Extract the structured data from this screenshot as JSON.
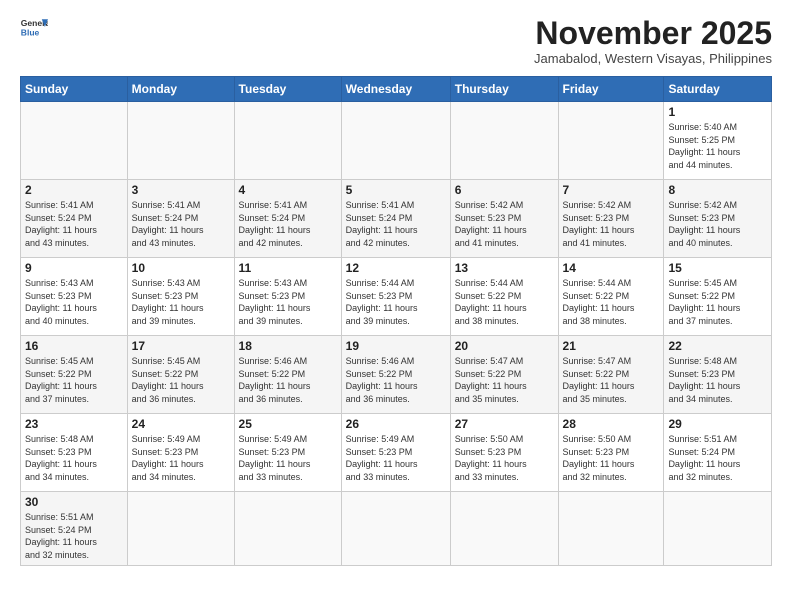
{
  "header": {
    "logo_general": "General",
    "logo_blue": "Blue",
    "month_title": "November 2025",
    "subtitle": "Jamabalod, Western Visayas, Philippines"
  },
  "weekdays": [
    "Sunday",
    "Monday",
    "Tuesday",
    "Wednesday",
    "Thursday",
    "Friday",
    "Saturday"
  ],
  "weeks": [
    [
      {
        "day": "",
        "info": ""
      },
      {
        "day": "",
        "info": ""
      },
      {
        "day": "",
        "info": ""
      },
      {
        "day": "",
        "info": ""
      },
      {
        "day": "",
        "info": ""
      },
      {
        "day": "",
        "info": ""
      },
      {
        "day": "1",
        "info": "Sunrise: 5:40 AM\nSunset: 5:25 PM\nDaylight: 11 hours\nand 44 minutes."
      }
    ],
    [
      {
        "day": "2",
        "info": "Sunrise: 5:41 AM\nSunset: 5:24 PM\nDaylight: 11 hours\nand 43 minutes."
      },
      {
        "day": "3",
        "info": "Sunrise: 5:41 AM\nSunset: 5:24 PM\nDaylight: 11 hours\nand 43 minutes."
      },
      {
        "day": "4",
        "info": "Sunrise: 5:41 AM\nSunset: 5:24 PM\nDaylight: 11 hours\nand 42 minutes."
      },
      {
        "day": "5",
        "info": "Sunrise: 5:41 AM\nSunset: 5:24 PM\nDaylight: 11 hours\nand 42 minutes."
      },
      {
        "day": "6",
        "info": "Sunrise: 5:42 AM\nSunset: 5:23 PM\nDaylight: 11 hours\nand 41 minutes."
      },
      {
        "day": "7",
        "info": "Sunrise: 5:42 AM\nSunset: 5:23 PM\nDaylight: 11 hours\nand 41 minutes."
      },
      {
        "day": "8",
        "info": "Sunrise: 5:42 AM\nSunset: 5:23 PM\nDaylight: 11 hours\nand 40 minutes."
      }
    ],
    [
      {
        "day": "9",
        "info": "Sunrise: 5:43 AM\nSunset: 5:23 PM\nDaylight: 11 hours\nand 40 minutes."
      },
      {
        "day": "10",
        "info": "Sunrise: 5:43 AM\nSunset: 5:23 PM\nDaylight: 11 hours\nand 39 minutes."
      },
      {
        "day": "11",
        "info": "Sunrise: 5:43 AM\nSunset: 5:23 PM\nDaylight: 11 hours\nand 39 minutes."
      },
      {
        "day": "12",
        "info": "Sunrise: 5:44 AM\nSunset: 5:23 PM\nDaylight: 11 hours\nand 39 minutes."
      },
      {
        "day": "13",
        "info": "Sunrise: 5:44 AM\nSunset: 5:22 PM\nDaylight: 11 hours\nand 38 minutes."
      },
      {
        "day": "14",
        "info": "Sunrise: 5:44 AM\nSunset: 5:22 PM\nDaylight: 11 hours\nand 38 minutes."
      },
      {
        "day": "15",
        "info": "Sunrise: 5:45 AM\nSunset: 5:22 PM\nDaylight: 11 hours\nand 37 minutes."
      }
    ],
    [
      {
        "day": "16",
        "info": "Sunrise: 5:45 AM\nSunset: 5:22 PM\nDaylight: 11 hours\nand 37 minutes."
      },
      {
        "day": "17",
        "info": "Sunrise: 5:45 AM\nSunset: 5:22 PM\nDaylight: 11 hours\nand 36 minutes."
      },
      {
        "day": "18",
        "info": "Sunrise: 5:46 AM\nSunset: 5:22 PM\nDaylight: 11 hours\nand 36 minutes."
      },
      {
        "day": "19",
        "info": "Sunrise: 5:46 AM\nSunset: 5:22 PM\nDaylight: 11 hours\nand 36 minutes."
      },
      {
        "day": "20",
        "info": "Sunrise: 5:47 AM\nSunset: 5:22 PM\nDaylight: 11 hours\nand 35 minutes."
      },
      {
        "day": "21",
        "info": "Sunrise: 5:47 AM\nSunset: 5:22 PM\nDaylight: 11 hours\nand 35 minutes."
      },
      {
        "day": "22",
        "info": "Sunrise: 5:48 AM\nSunset: 5:23 PM\nDaylight: 11 hours\nand 34 minutes."
      }
    ],
    [
      {
        "day": "23",
        "info": "Sunrise: 5:48 AM\nSunset: 5:23 PM\nDaylight: 11 hours\nand 34 minutes."
      },
      {
        "day": "24",
        "info": "Sunrise: 5:49 AM\nSunset: 5:23 PM\nDaylight: 11 hours\nand 34 minutes."
      },
      {
        "day": "25",
        "info": "Sunrise: 5:49 AM\nSunset: 5:23 PM\nDaylight: 11 hours\nand 33 minutes."
      },
      {
        "day": "26",
        "info": "Sunrise: 5:49 AM\nSunset: 5:23 PM\nDaylight: 11 hours\nand 33 minutes."
      },
      {
        "day": "27",
        "info": "Sunrise: 5:50 AM\nSunset: 5:23 PM\nDaylight: 11 hours\nand 33 minutes."
      },
      {
        "day": "28",
        "info": "Sunrise: 5:50 AM\nSunset: 5:23 PM\nDaylight: 11 hours\nand 32 minutes."
      },
      {
        "day": "29",
        "info": "Sunrise: 5:51 AM\nSunset: 5:24 PM\nDaylight: 11 hours\nand 32 minutes."
      }
    ],
    [
      {
        "day": "30",
        "info": "Sunrise: 5:51 AM\nSunset: 5:24 PM\nDaylight: 11 hours\nand 32 minutes."
      },
      {
        "day": "",
        "info": ""
      },
      {
        "day": "",
        "info": ""
      },
      {
        "day": "",
        "info": ""
      },
      {
        "day": "",
        "info": ""
      },
      {
        "day": "",
        "info": ""
      },
      {
        "day": "",
        "info": ""
      }
    ]
  ]
}
